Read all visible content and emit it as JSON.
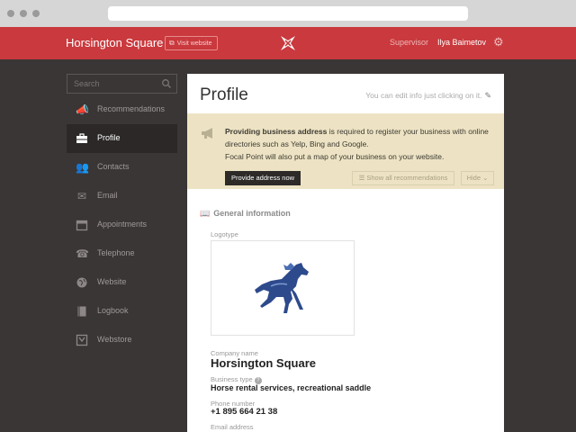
{
  "header": {
    "brand": "Horsington Square",
    "visit_label": "Visit website",
    "role": "Supervisor",
    "user_name": "Ilya Baimetov"
  },
  "sidebar": {
    "search_placeholder": "Search",
    "active": "Profile",
    "items": [
      {
        "label": "Recommendations",
        "icon": "megaphone-icon"
      },
      {
        "label": "Profile",
        "icon": "briefcase-icon"
      },
      {
        "label": "Contacts",
        "icon": "people-icon"
      },
      {
        "label": "Email",
        "icon": "envelope-icon"
      },
      {
        "label": "Appointments",
        "icon": "calendar-icon"
      },
      {
        "label": "Telephone",
        "icon": "phone-icon"
      },
      {
        "label": "Website",
        "icon": "globe-icon"
      },
      {
        "label": "Logbook",
        "icon": "book-icon"
      },
      {
        "label": "Webstore",
        "icon": "store-icon"
      }
    ]
  },
  "main": {
    "title": "Profile",
    "edit_hint": "You can edit info just clicking on it.",
    "banner": {
      "bold": "Providing business address",
      "text": " is required to register your business with online directories such as Yelp, Bing and Google.",
      "line2": "Focal Point will also put a map of your business on your website.",
      "provide_button": "Provide address now",
      "show_all": "Show all recommendations",
      "hide": "Hide"
    },
    "section_title": "General information",
    "fields": {
      "logotype_label": "Logotype",
      "company_name_label": "Company name",
      "company_name": "Horsington Square",
      "business_type_label": "Business type",
      "business_type": "Horse rental services, recreational saddle",
      "phone_label": "Phone number",
      "phone": "+1 895 664 21 38",
      "email_label": "Email address"
    }
  },
  "colors": {
    "header_red": "#c9393d",
    "sidebar_bg": "#3a3635",
    "banner_bg": "#ede3c4",
    "horse_blue": "#2d4a8c"
  }
}
